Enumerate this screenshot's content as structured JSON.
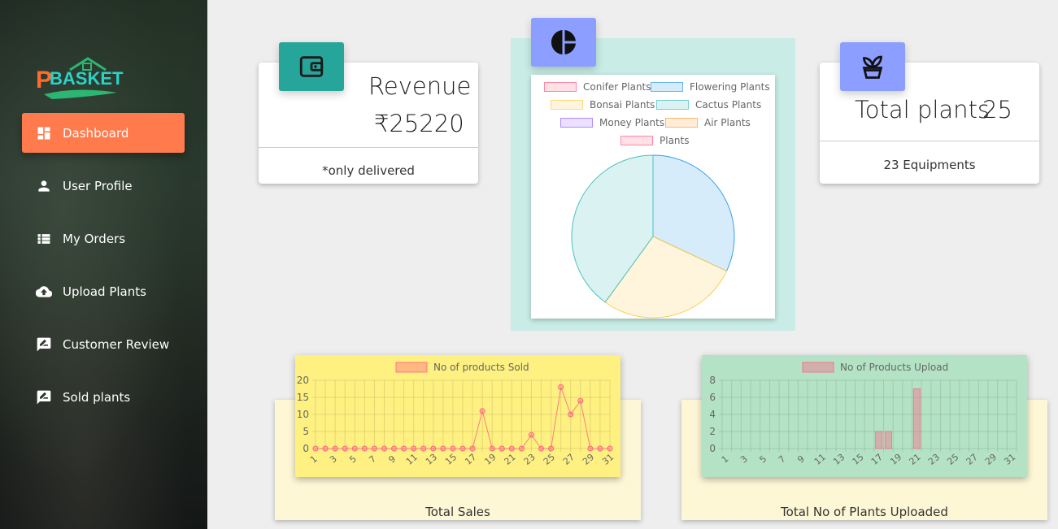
{
  "brand": {
    "logo_text": "PBASKET"
  },
  "sidebar": {
    "items": [
      {
        "label": "Dashboard",
        "icon": "dashboard-icon",
        "active": true
      },
      {
        "label": "User Profile",
        "icon": "person-icon"
      },
      {
        "label": "My Orders",
        "icon": "list-icon"
      },
      {
        "label": "Upload Plants",
        "icon": "cloud-upload-icon"
      },
      {
        "label": "Customer Review",
        "icon": "rate-review-icon"
      },
      {
        "label": "Sold plants",
        "icon": "rate-review-icon"
      }
    ]
  },
  "revenue_card": {
    "title": "Revenue",
    "value": "₹25220",
    "footer": "*only delivered",
    "icon": "wallet-icon",
    "accent": "#26a69a"
  },
  "plants_card": {
    "title": "Total plants",
    "value": "25",
    "footer": "23 Equipments",
    "icon": "plant-pot-icon",
    "accent": "#8c9eff"
  },
  "pie_card": {
    "icon": "pie-chart-icon",
    "accent": "#8c9eff",
    "background": "#c9ece6"
  },
  "sales_card": {
    "label": "Total Sales"
  },
  "uploads_card": {
    "label": "Total No of Plants Uploaded"
  },
  "chart_data": [
    {
      "type": "pie",
      "legend": [
        {
          "name": "Conifer Plants",
          "color": "#ff6384"
        },
        {
          "name": "Flowering Plants",
          "color": "#36a2eb"
        },
        {
          "name": "Bonsai Plants",
          "color": "#ffce56"
        },
        {
          "name": "Cactus Plants",
          "color": "#4bc0c0"
        },
        {
          "name": "Money Plants",
          "color": "#9966ff"
        },
        {
          "name": "Air Plants",
          "color": "#ff9f40"
        },
        {
          "name": "Plants",
          "color": "#ff6384"
        }
      ],
      "legend_position": "top",
      "slices": [
        {
          "name": "Flowering Plants",
          "value": 8,
          "color": "#36a2eb"
        },
        {
          "name": "Bonsai Plants",
          "value": 7,
          "color": "#ffce56"
        },
        {
          "name": "Cactus Plants",
          "value": 10,
          "color": "#4bc0c0"
        }
      ]
    },
    {
      "type": "line",
      "series_name": "No of products Sold",
      "background": "#fef081",
      "line_color": "#ff6384",
      "x": [
        1,
        2,
        3,
        4,
        5,
        6,
        7,
        8,
        9,
        10,
        11,
        12,
        13,
        14,
        15,
        16,
        17,
        18,
        19,
        20,
        21,
        22,
        23,
        24,
        25,
        26,
        27,
        28,
        29,
        30,
        31
      ],
      "x_tick_labels": [
        "1",
        "3",
        "5",
        "7",
        "9",
        "11",
        "13",
        "15",
        "17",
        "19",
        "21",
        "23",
        "25",
        "27",
        "29",
        "31"
      ],
      "values": [
        0,
        0,
        0,
        0,
        0,
        0,
        0,
        0,
        0,
        0,
        0,
        0,
        0,
        0,
        0,
        0,
        0,
        11,
        0,
        0,
        0,
        0,
        4,
        0,
        0,
        18,
        10,
        14,
        0,
        0,
        0
      ],
      "y_ticks": [
        0,
        5,
        10,
        15,
        20
      ],
      "ylim": [
        0,
        20
      ],
      "grid": true,
      "legend_position": "top"
    },
    {
      "type": "bar",
      "series_name": "No of Products Upload",
      "background": "#b3e2c4",
      "bar_color": "#ff6384",
      "x": [
        1,
        2,
        3,
        4,
        5,
        6,
        7,
        8,
        9,
        10,
        11,
        12,
        13,
        14,
        15,
        16,
        17,
        18,
        19,
        20,
        21,
        22,
        23,
        24,
        25,
        26,
        27,
        28,
        29,
        30,
        31
      ],
      "x_tick_labels": [
        "1",
        "3",
        "5",
        "7",
        "9",
        "11",
        "13",
        "15",
        "17",
        "19",
        "21",
        "23",
        "25",
        "27",
        "29",
        "31"
      ],
      "values": [
        0,
        0,
        0,
        0,
        0,
        0,
        0,
        0,
        0,
        0,
        0,
        0,
        0,
        0,
        0,
        0,
        2,
        2,
        0,
        0,
        7,
        0,
        0,
        0,
        0,
        0,
        0,
        0,
        0,
        0,
        0
      ],
      "y_ticks": [
        0,
        2,
        4,
        6,
        8
      ],
      "ylim": [
        0,
        8
      ],
      "grid": true,
      "legend_position": "top"
    }
  ]
}
